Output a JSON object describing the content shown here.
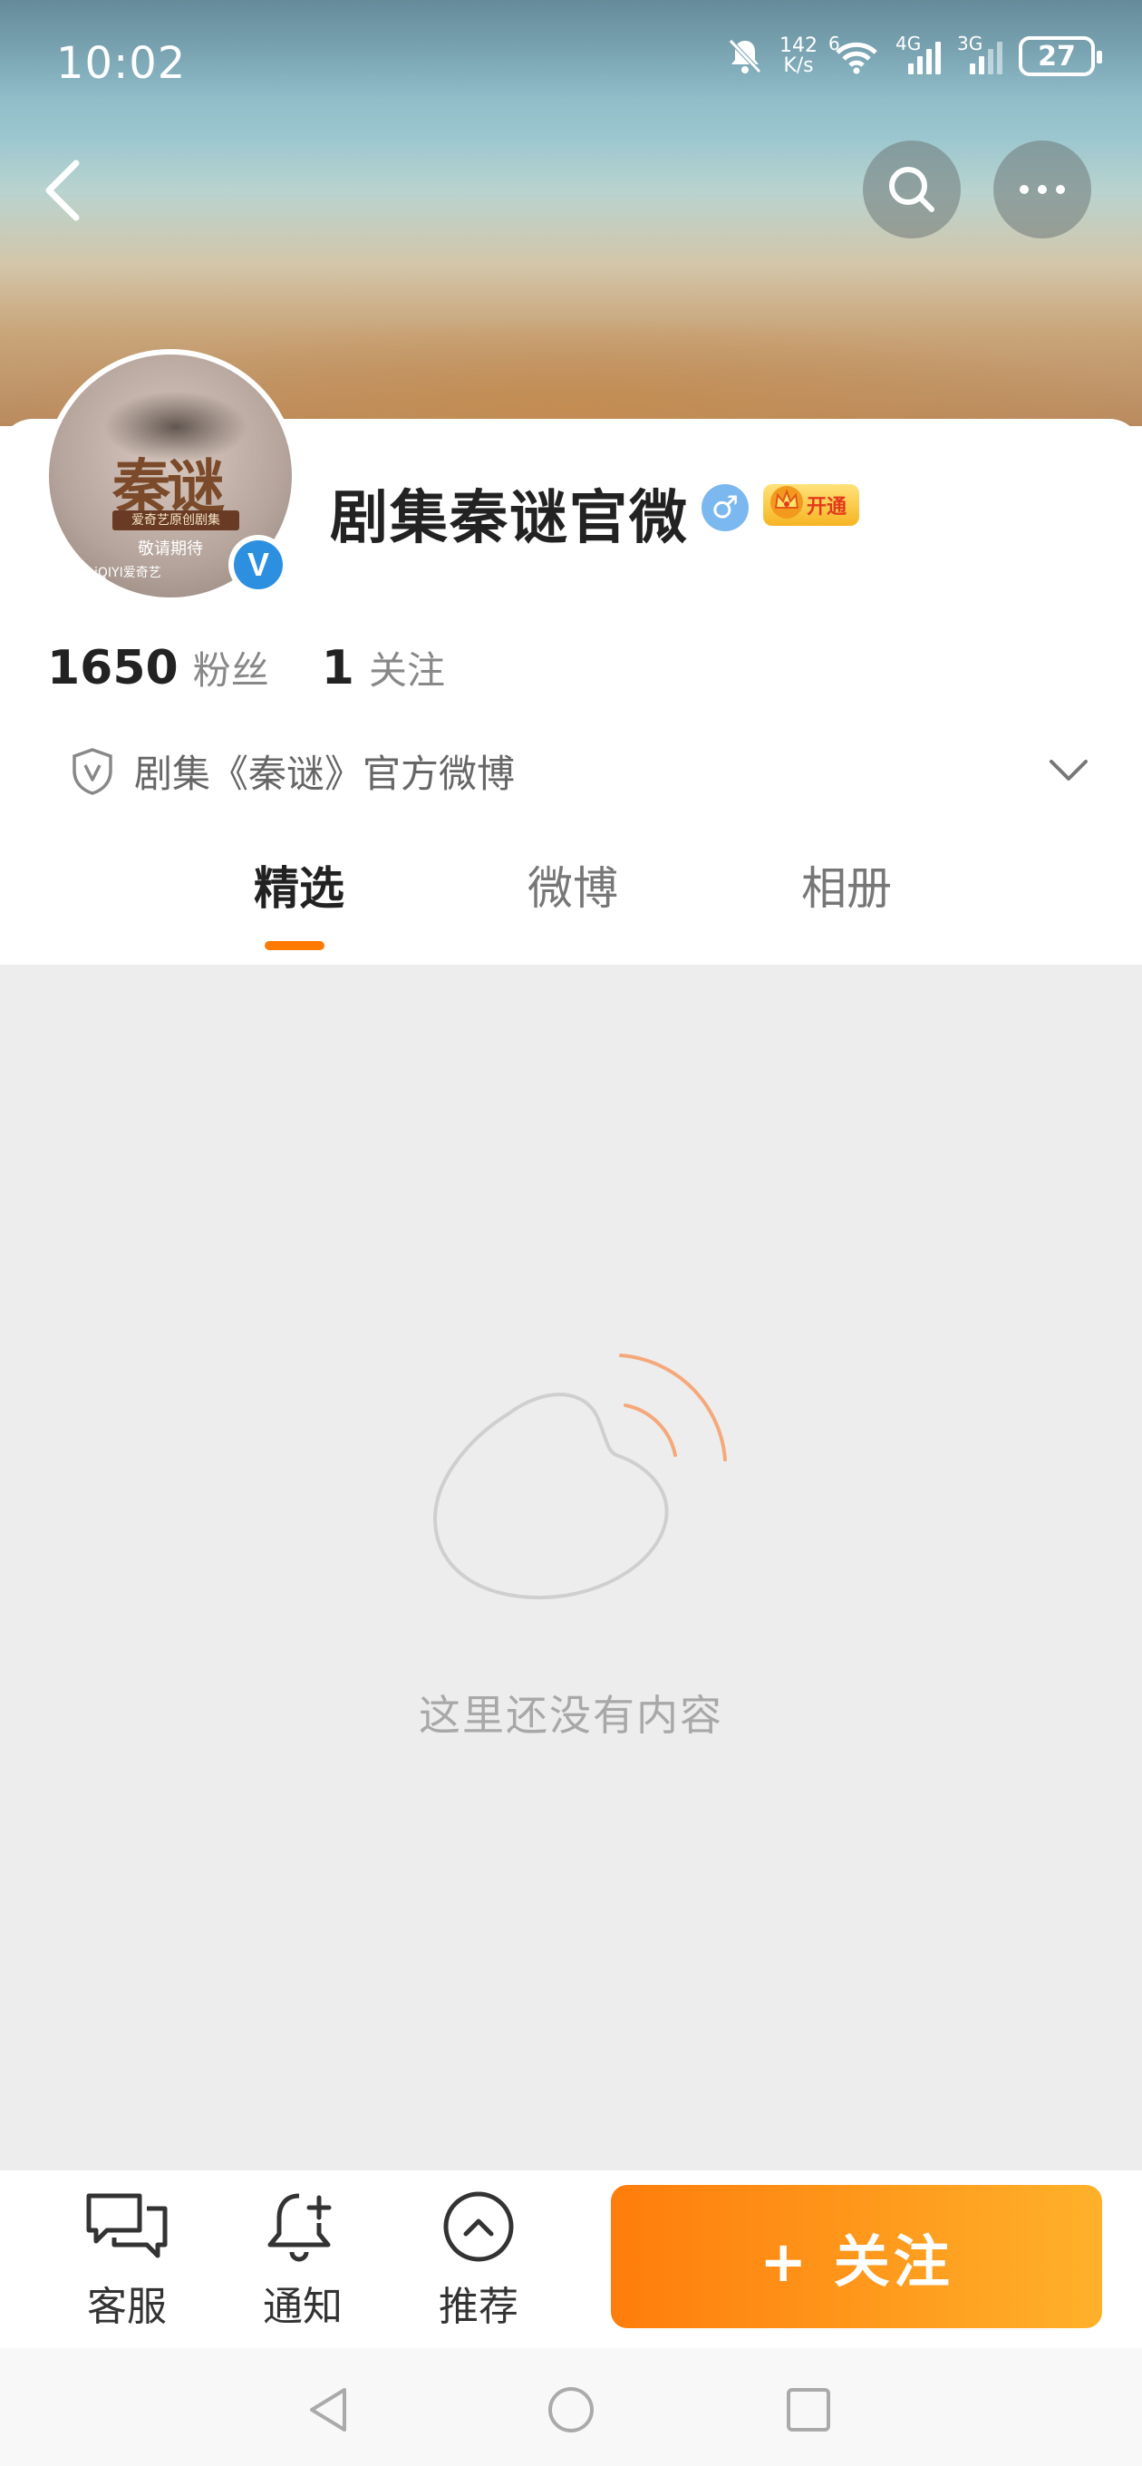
{
  "status_bar": {
    "time": "10:02",
    "net_speed_value": "142",
    "net_speed_unit": "K/s",
    "wifi_tag": "6",
    "signal1_tag": "4G",
    "signal2_tag": "3G",
    "battery": "27"
  },
  "profile": {
    "name": "剧集秦谜官微",
    "gender_symbol": "♂",
    "vip_label": "开通",
    "verified_mark": "V",
    "followers_count": "1650",
    "followers_label": "粉丝",
    "following_count": "1",
    "following_label": "关注",
    "description": "剧集《秦谜》官方微博",
    "avatar": {
      "title": "秦谜",
      "band": "爱奇艺原创剧集",
      "subtitle": "敬请期待",
      "logos": "iQIYI爱奇艺"
    }
  },
  "tabs": [
    {
      "label": "精选",
      "active": true
    },
    {
      "label": "微博",
      "active": false
    },
    {
      "label": "相册",
      "active": false
    }
  ],
  "empty_state": {
    "message": "这里还没有内容"
  },
  "bottom_actions": {
    "service_label": "客服",
    "notify_label": "通知",
    "recommend_label": "推荐",
    "follow_label": "+ 关注"
  },
  "colors": {
    "accent": "#ff7a00",
    "verified_blue": "#2c8fe0",
    "empty_bg": "#ededed"
  }
}
